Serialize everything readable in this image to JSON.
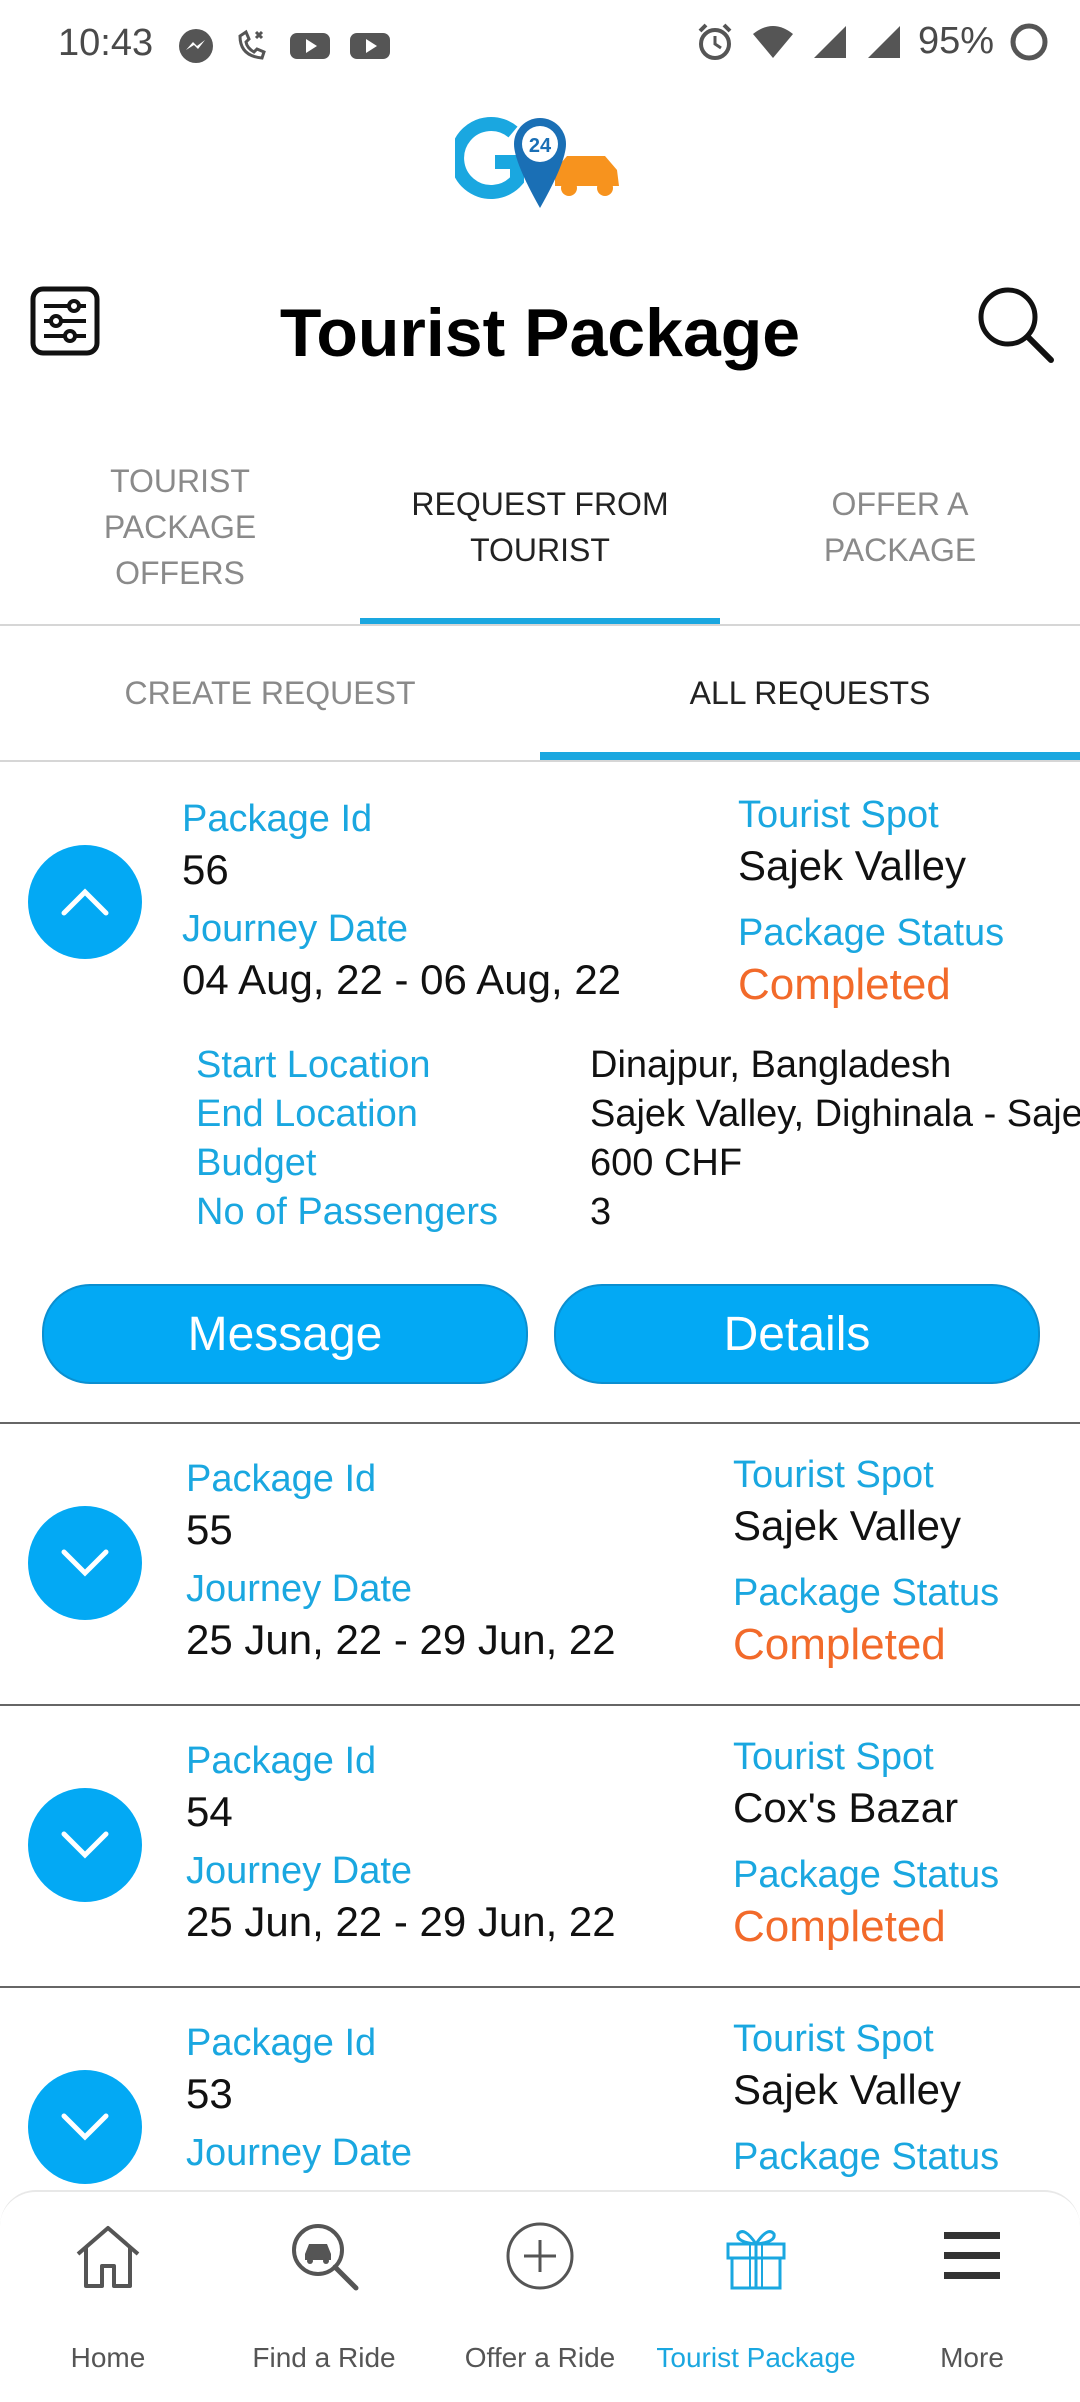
{
  "status_bar": {
    "time": "10:43",
    "battery": "95%",
    "left_icons": [
      "messenger-icon",
      "missed-call-icon",
      "youtube-icon",
      "youtube-icon"
    ],
    "right_icons": [
      "alarm-icon",
      "wifi-icon",
      "signal-icon",
      "signal-icon",
      "battery-ring-icon"
    ]
  },
  "header": {
    "logo_text": "24",
    "title": "Tourist Package",
    "filter_icon": "sliders-icon",
    "search_icon": "search-icon"
  },
  "tabs": [
    {
      "label": "TOURIST\nPACKAGE\nOFFERS",
      "active": false
    },
    {
      "label": "REQUEST FROM\nTOURIST",
      "active": true
    },
    {
      "label": "OFFER A\nPACKAGE",
      "active": false
    }
  ],
  "subtabs": [
    {
      "label": "CREATE REQUEST",
      "active": false
    },
    {
      "label": "ALL REQUESTS",
      "active": true
    }
  ],
  "labels": {
    "package_id": "Package Id",
    "journey_date": "Journey Date",
    "tourist_spot": "Tourist Spot",
    "package_status": "Package Status",
    "start_location": "Start Location",
    "end_location": "End Location",
    "budget": "Budget",
    "passengers": "No of Passengers"
  },
  "requests": [
    {
      "id": "56",
      "journey_date": "04 Aug, 22 - 06 Aug, 22",
      "spot": "Sajek Valley",
      "status": "Completed",
      "expanded": true,
      "start_location": "Dinajpur, Bangladesh",
      "end_location": "Sajek Valley, Dighinala - Saje",
      "budget": "600 CHF",
      "passengers": "3",
      "message_label": "Message",
      "details_label": "Details"
    },
    {
      "id": "55",
      "journey_date": "25 Jun, 22 - 29 Jun, 22",
      "spot": "Sajek Valley",
      "status": "Completed",
      "expanded": false
    },
    {
      "id": "54",
      "journey_date": "25 Jun, 22 - 29 Jun, 22",
      "spot": "Cox's Bazar",
      "status": "Completed",
      "expanded": false
    },
    {
      "id": "53",
      "journey_date": "",
      "spot": "Sajek Valley",
      "status": "",
      "expanded": false
    }
  ],
  "bottom_nav": [
    {
      "label": "Home",
      "icon": "home-icon",
      "active": false
    },
    {
      "label": "Find a Ride",
      "icon": "find-ride-icon",
      "active": false
    },
    {
      "label": "Offer a Ride",
      "icon": "plus-circle-icon",
      "active": false
    },
    {
      "label": "Tourist Package",
      "icon": "gift-icon",
      "active": true
    },
    {
      "label": "More",
      "icon": "menu-icon",
      "active": false
    }
  ],
  "colors": {
    "accent": "#03a9f4",
    "label_blue": "#1aa7e0",
    "status_orange": "#f26a2a",
    "logo_orange": "#f7931e"
  }
}
